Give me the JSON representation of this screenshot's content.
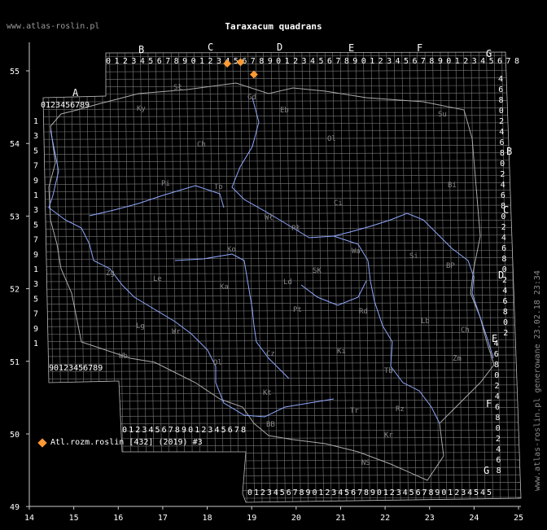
{
  "site": "www.atlas-roslin.pl",
  "title": "Taraxacum quadrans",
  "legend": {
    "label": "Atl.rozm.roslin [432] (2019) #3",
    "color": "#ff9933"
  },
  "stamp": "www.atlas-roslin.pl generowane 23.02.18 23:34",
  "axes": {
    "x_ticks": [
      "14",
      "15",
      "16",
      "17",
      "18",
      "19",
      "20",
      "21",
      "22",
      "23",
      "24",
      "25"
    ],
    "y_ticks": [
      "55",
      "54",
      "53",
      "52",
      "51",
      "50",
      "49"
    ]
  },
  "grid_letters": {
    "top": [
      "A",
      "B",
      "C",
      "D",
      "E",
      "F",
      "G"
    ],
    "right": [
      "A",
      "B",
      "C",
      "D",
      "E",
      "F",
      "G"
    ]
  },
  "digit_rows": {
    "top_A": "0123456789",
    "top_main": "0123456789012345678901234567890123456789012345678",
    "left_a_col": "1357913579135791",
    "bottom_left": "90123456789",
    "bottom_mid": "0123456789012345678",
    "bottom_main": "01234567890123456789012345678901234545"
  },
  "region_labels": [
    {
      "t": "Sł"
    },
    {
      "t": "Ky"
    },
    {
      "t": "Gd"
    },
    {
      "t": "Eb"
    },
    {
      "t": "Su"
    },
    {
      "t": "Ch"
    },
    {
      "t": "Ol"
    },
    {
      "t": "Pi"
    },
    {
      "t": "To"
    },
    {
      "t": "Ci"
    },
    {
      "t": "Bi"
    },
    {
      "t": "Wł"
    },
    {
      "t": "Pł"
    },
    {
      "t": "Ko"
    },
    {
      "t": "Wa"
    },
    {
      "t": "Si"
    },
    {
      "t": "BP"
    },
    {
      "t": "SK"
    },
    {
      "t": "Ka"
    },
    {
      "t": "Ld"
    },
    {
      "t": "Zg"
    },
    {
      "t": "Le"
    },
    {
      "t": "Pt"
    },
    {
      "t": "Rd"
    },
    {
      "t": "Lb"
    },
    {
      "t": "Ch"
    },
    {
      "t": "Lg"
    },
    {
      "t": "Wr"
    },
    {
      "t": "Wb"
    },
    {
      "t": "Cz"
    },
    {
      "t": "Ki"
    },
    {
      "t": "Zm"
    },
    {
      "t": "Kt"
    },
    {
      "t": "Tr"
    },
    {
      "t": "Ol"
    },
    {
      "t": "BB"
    },
    {
      "t": "NS"
    },
    {
      "t": "Kr"
    },
    {
      "t": "Tb"
    },
    {
      "t": "Rz"
    }
  ],
  "occurrences": [
    {
      "lon": 18.45,
      "lat": 55.1
    },
    {
      "lon": 18.75,
      "lat": 55.12
    },
    {
      "lon": 19.05,
      "lat": 54.95
    }
  ]
}
